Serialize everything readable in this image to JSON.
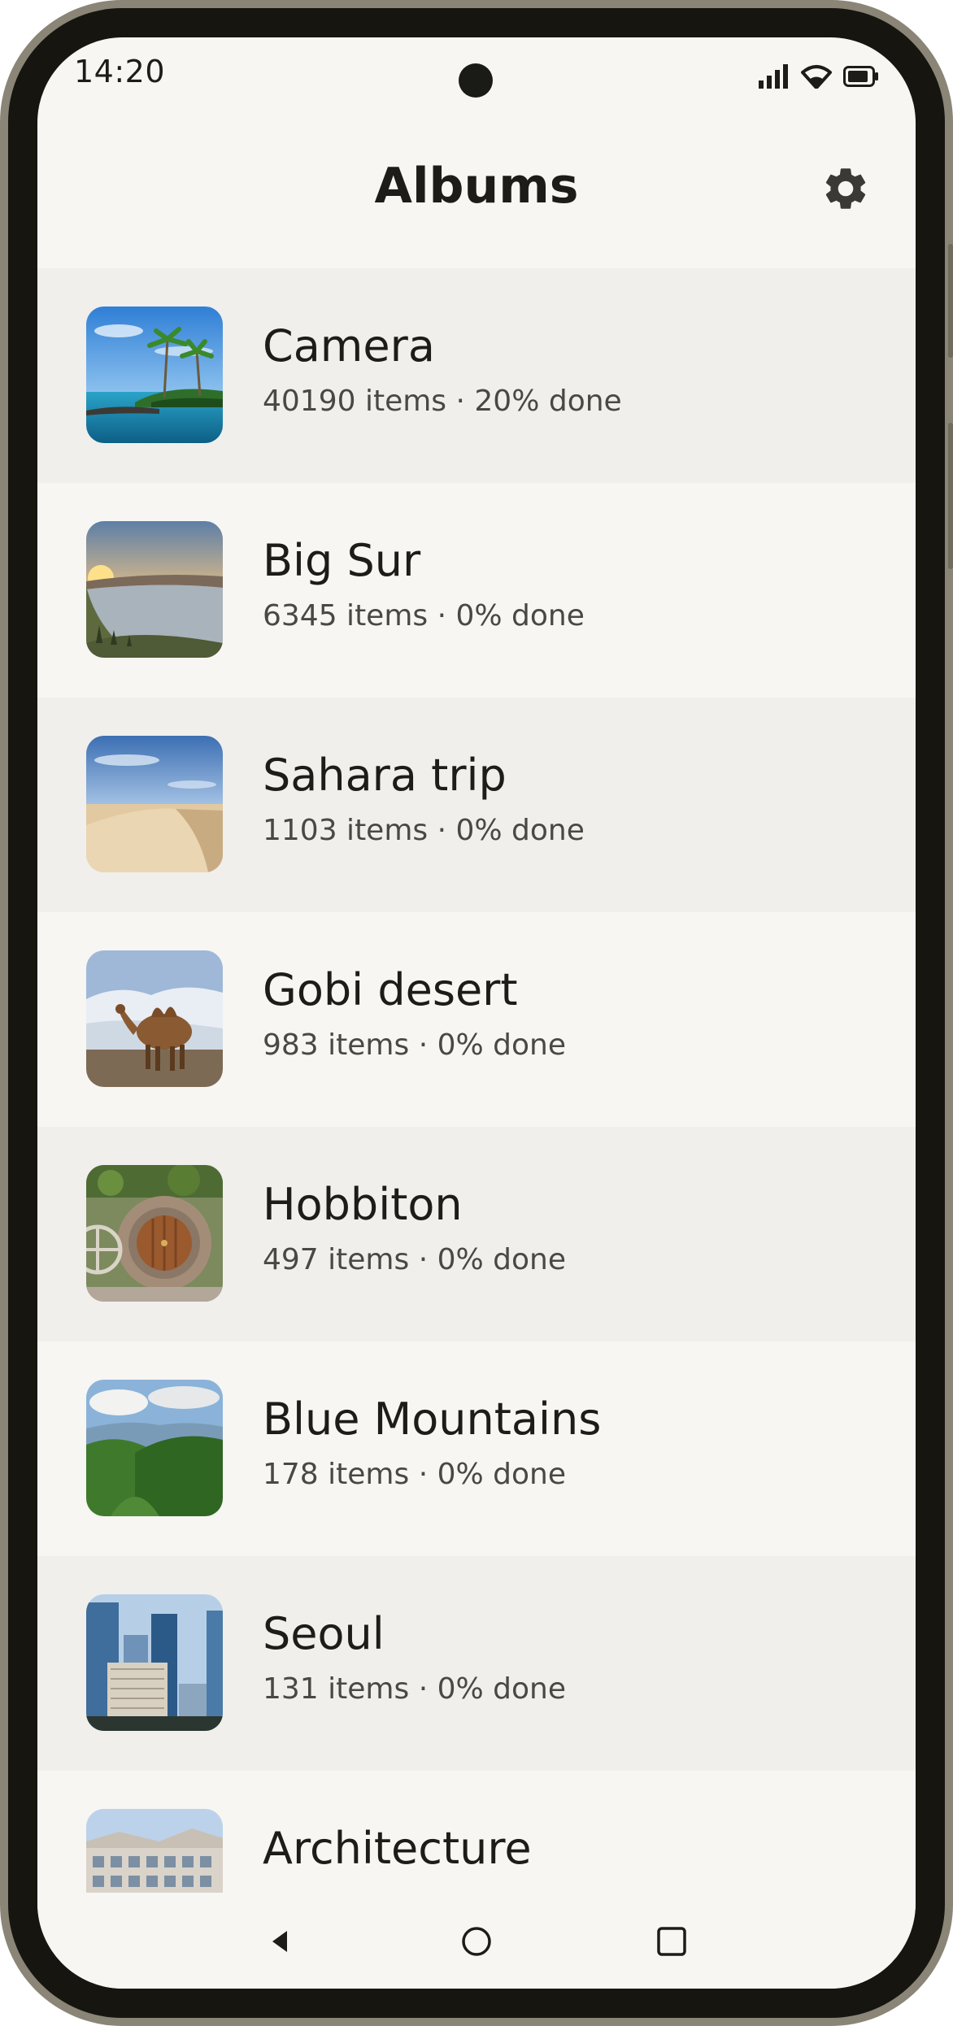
{
  "status_bar": {
    "time": "14:20",
    "icons": [
      "signal-icon",
      "wifi-icon",
      "battery-icon"
    ]
  },
  "header": {
    "title": "Albums",
    "settings_icon": "gear-icon"
  },
  "albums": [
    {
      "name": "Camera",
      "meta": "40190 items · 20% done",
      "thumbnail": "tropical-island-photo"
    },
    {
      "name": "Big Sur",
      "meta": "6345 items · 0% done",
      "thumbnail": "coastal-sunset-photo"
    },
    {
      "name": "Sahara trip",
      "meta": "1103 items · 0% done",
      "thumbnail": "sand-dunes-photo"
    },
    {
      "name": "Gobi desert",
      "meta": "983 items · 0% done",
      "thumbnail": "camel-photo"
    },
    {
      "name": "Hobbiton",
      "meta": "497 items · 0% done",
      "thumbnail": "hobbit-door-photo"
    },
    {
      "name": "Blue Mountains",
      "meta": "178 items · 0% done",
      "thumbnail": "mountain-valley-photo"
    },
    {
      "name": "Seoul",
      "meta": "131 items · 0% done",
      "thumbnail": "city-skyline-photo"
    },
    {
      "name": "Architecture",
      "meta": "",
      "thumbnail": "building-photo"
    }
  ],
  "nav_bar": {
    "icons": [
      "back-icon",
      "home-icon",
      "recents-icon"
    ]
  },
  "colors": {
    "background": "#f7f6f3",
    "row_alt": "#f0efec",
    "text_primary": "#1d1c18",
    "text_secondary": "#4a4843"
  }
}
